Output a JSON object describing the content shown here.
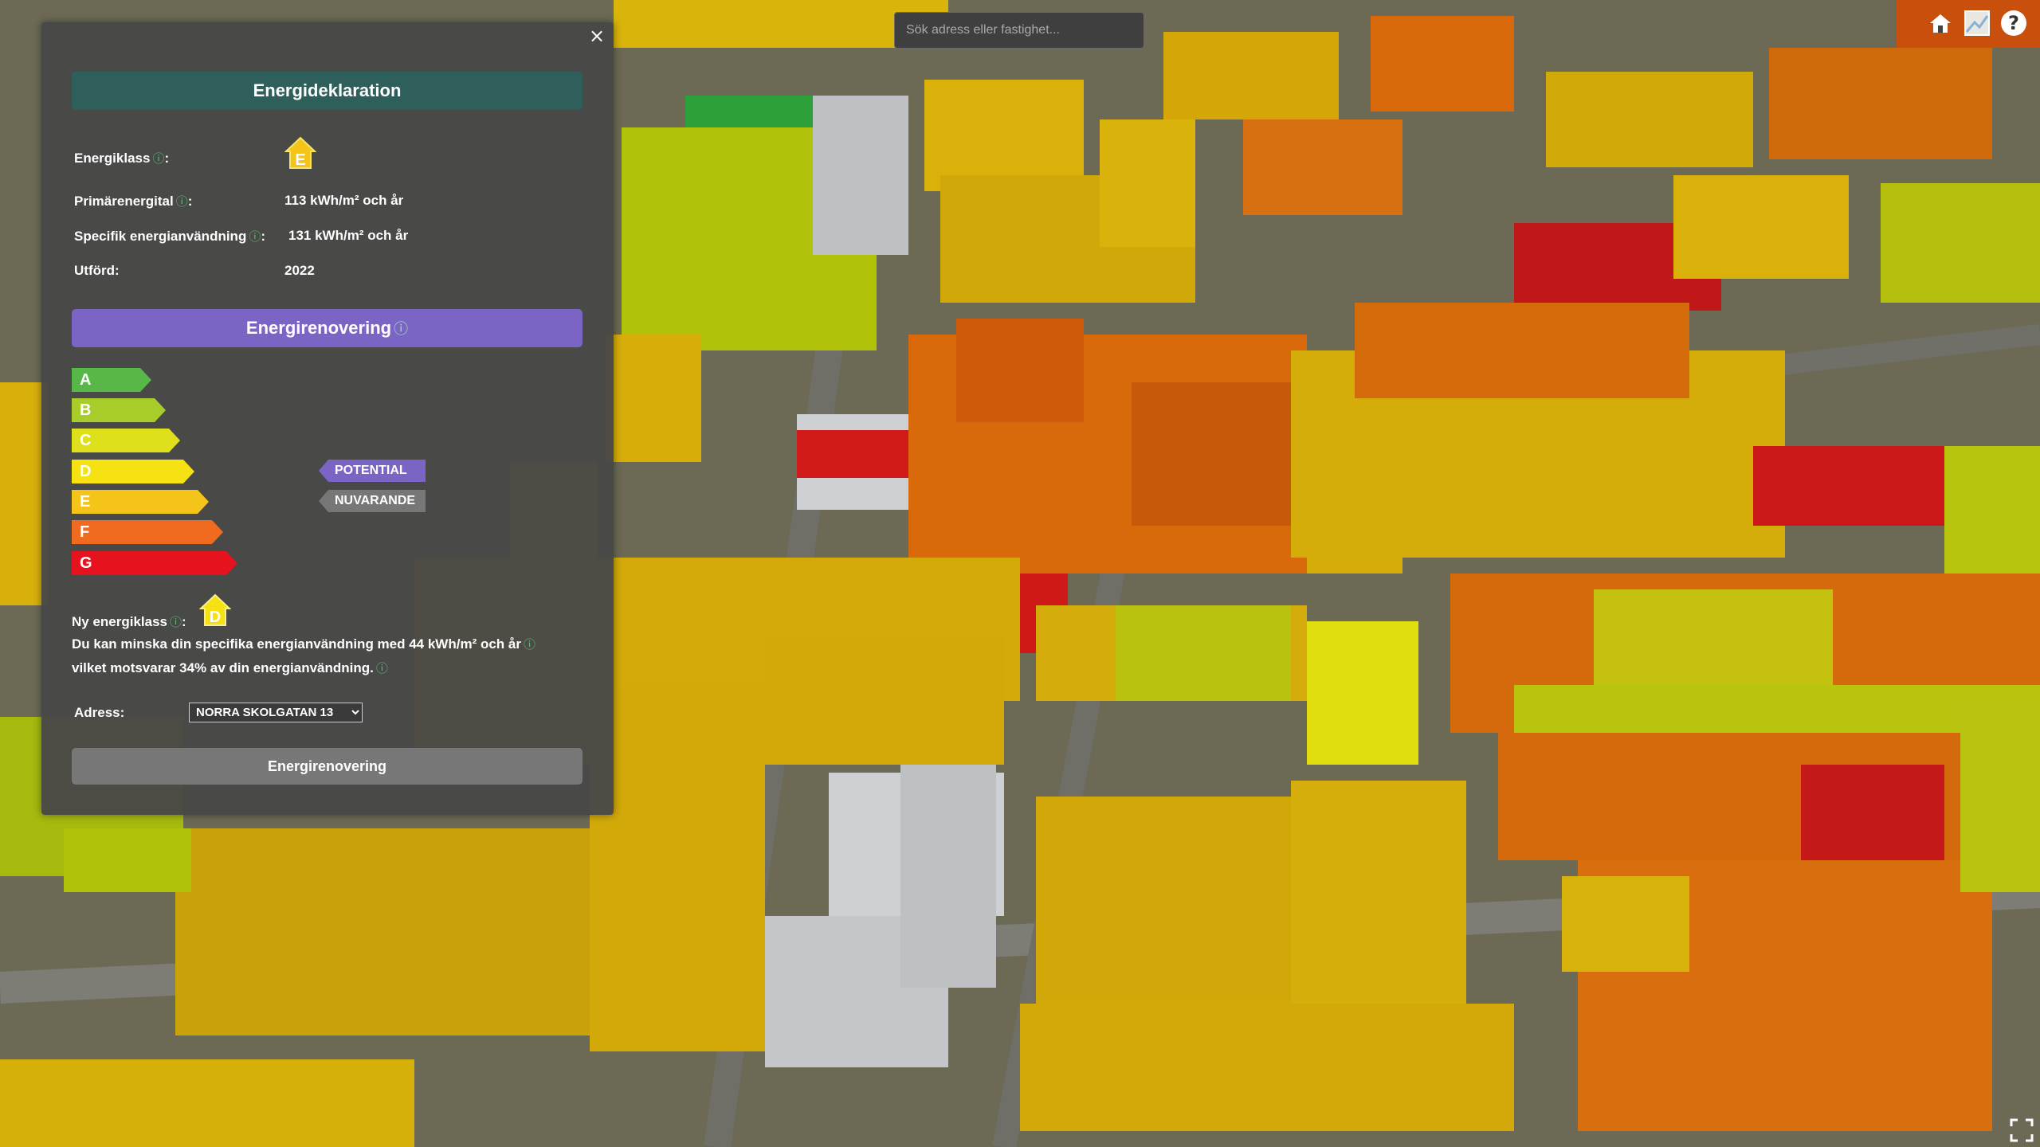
{
  "search": {
    "placeholder": "Sök adress eller fastighet..."
  },
  "toolbar": {
    "home_icon": "home-icon",
    "map_icon": "basemap-icon",
    "help_icon": "help-icon",
    "fullscreen_icon": "fullscreen-icon"
  },
  "panel": {
    "close_label": "×",
    "declaration_title": "Energideklaration",
    "energy_class_label": "Energiklass",
    "energy_class_value": "E",
    "primary_energy_label": "Primärenergital",
    "primary_energy_value": "113 kWh/m² och år",
    "specific_use_label": "Specifik energianvändning",
    "specific_use_value": "131 kWh/m² och år",
    "performed_label": "Utförd:",
    "performed_value": "2022",
    "info_glyph": "ⓘ",
    "colon": ":",
    "renovation_title": "Energirenovering",
    "classes": [
      {
        "letter": "A",
        "color": "#57b847"
      },
      {
        "letter": "B",
        "color": "#a8cc2a"
      },
      {
        "letter": "C",
        "color": "#dde01a"
      },
      {
        "letter": "D",
        "color": "#f6e213"
      },
      {
        "letter": "E",
        "color": "#f5c419"
      },
      {
        "letter": "F",
        "color": "#f06b1f"
      },
      {
        "letter": "G",
        "color": "#e6121d"
      }
    ],
    "potential_label": "POTENTIAL",
    "potential_color": "#7a64c4",
    "current_label": "NUVARANDE",
    "current_color": "#777777",
    "new_class_label": "Ny energiklass",
    "new_class_value": "D",
    "saving_text": "Du kan minska din specifika energianvändning med 44 kWh/m² och år",
    "saving_text2": "vilket motsvarar 34% av din energianvändning.",
    "address_label": "Adress:",
    "address_value": "NORRA SKOLGATAN 13",
    "button_label": "Energirenovering"
  }
}
